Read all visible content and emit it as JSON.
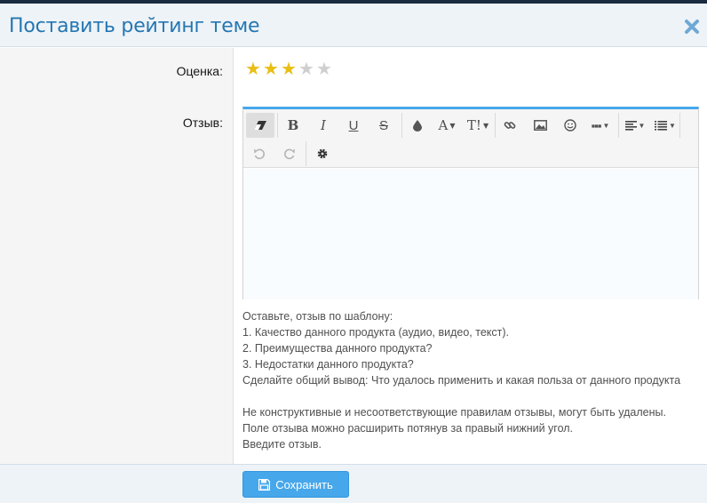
{
  "dialog": {
    "title": "Поставить рейтинг теме",
    "close_icon": "close-icon"
  },
  "form": {
    "rating_label": "Оценка:",
    "rating_value": 3,
    "rating_max": 5,
    "review_label": "Отзыв:"
  },
  "toolbar": {
    "row1": [
      "remove-format-icon",
      "bold-icon",
      "italic-icon",
      "underline-icon",
      "strikethrough-icon",
      "color-icon",
      "font-family-icon",
      "font-size-icon",
      "link-icon",
      "image-icon",
      "smilie-icon",
      "more-icon",
      "align-icon",
      "list-icon"
    ],
    "row2": [
      "undo-icon",
      "redo-icon",
      "settings-icon"
    ],
    "bold_glyph": "B",
    "italic_glyph": "I",
    "underline_glyph": "U",
    "strike_glyph": "S",
    "font_glyph": "A",
    "size_glyph": "T!"
  },
  "hint": {
    "lines": [
      "Оставьте, отзыв по шаблону:",
      "1. Качество данного продукта (аудио, видео, текст).",
      "2. Преимущества данного продукта?",
      "3. Недостатки данного продукта?",
      "Сделайте общий вывод: Что удалось применить и какая польза от данного продукта",
      "",
      "Не конструктивные и несоответствующие правилам отзывы, могут быть удалены.",
      "Поле отзыва можно расширить потянув за правый нижний угол.",
      "Введите отзыв."
    ]
  },
  "footer": {
    "save_label": "Сохранить"
  },
  "colors": {
    "accent": "#47a7eb",
    "title": "#2577b1",
    "star_on": "#e9be15",
    "star_off": "#cfcfcf"
  }
}
